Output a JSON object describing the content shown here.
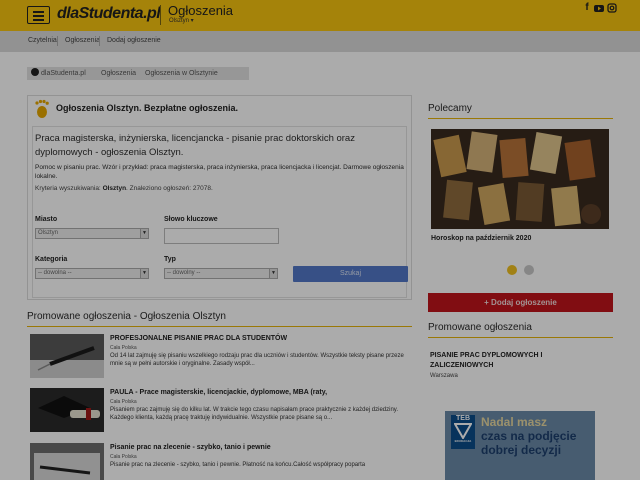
{
  "header": {
    "logo": "dlaStudenta.pl",
    "title": "Ogłoszenia",
    "city_selector": "Olsztyn"
  },
  "social": [
    "facebook-icon",
    "youtube-icon",
    "instagram-icon"
  ],
  "subnav": [
    "Czytelnia",
    "Ogłoszenia",
    "Dodaj ogłoszenie"
  ],
  "breadcrumb": [
    "dlaStudenta.pl",
    "Ogłoszenia",
    "Ogłoszenia w Olsztynie"
  ],
  "search_box": {
    "heading": "Ogłoszenia Olsztyn. Bezpłatne ogłoszenia.",
    "category_title": "Praca magisterska, inżynierska, licencjancka - pisanie prac doktorskich oraz dyplomowych - ogłoszenia Olsztyn.",
    "category_desc": "Pomoc w pisaniu prac. Wzór i przykład: praca magisterska, praca inżynierska, praca licencjacka i licencjat. Darmowe ogłoszenia lokalne.",
    "criteria_label": "Kryteria wyszukiwania:",
    "criteria_city": "Olsztyn",
    "found": ". Znaleziono ogłoszeń: 27078.",
    "city_label": "Miasto",
    "city_value": "Olsztyn",
    "keyword_label": "Słowo kluczowe",
    "keyword_value": "",
    "category_label": "Kategoria",
    "category_value": "-- dowolna --",
    "type_label": "Typ",
    "type_value": "-- dowolny --",
    "search_button": "Szukaj"
  },
  "promoted_left": {
    "title": "Promowane ogłoszenia - Ogłoszenia Olsztyn",
    "ads": [
      {
        "title": "PROFESJONALNE PISANIE PRAC DLA STUDENTÓW",
        "location": "Cała Polska",
        "text": "Od 14 lat zajmuję się pisaniu wszelkiego rodzaju prac dla uczniów i studentów. Wszystkie teksty pisane przeze mnie są w pełni autorskie i oryginalne.  Zasady współ..."
      },
      {
        "title": "PAULA - Prace magisterskie, licencjackie, dyplomowe, MBA (raty,",
        "location": "Cała Polska",
        "text": "Pisaniem prac zajmuję się do kilku lat. W trakcie tego czasu napisałam prace praktycznie z każdej dziedziny. Każdego klienta, każdą pracę traktuję indywidualnie. Wszystkie prace pisane są o..."
      },
      {
        "title": "Pisanie prac na zlecenie - szybko, tanio i pewnie",
        "location": "Cała Polska",
        "text": "Pisanie prac na zlecenie - szybko, tanio i pewnie. Płatność na końcu.Całość współpracy poparta"
      }
    ]
  },
  "right": {
    "recommended_title": "Polecamy",
    "slider_caption": "Horoskop na październik 2020",
    "add_button": "+ Dodaj ogłoszenie",
    "promoted_title": "Promowane ogłoszenia",
    "promoted_ad_title": "PISANIE PRAC DYPLOMOWYCH I ZALICZENIOWYCH",
    "promoted_ad_location": "Warszawa",
    "banner_brand": "TEB",
    "banner_brand_sub": "EDUKACJA",
    "banner_lines": [
      "Nadal masz",
      "czas na podjęcie",
      "dobrej decyzji"
    ]
  },
  "colors": {
    "header": "#f6c30f",
    "accent_red": "#c0141c",
    "search_button": "#5278c8",
    "section_line": "#e6b40a"
  }
}
